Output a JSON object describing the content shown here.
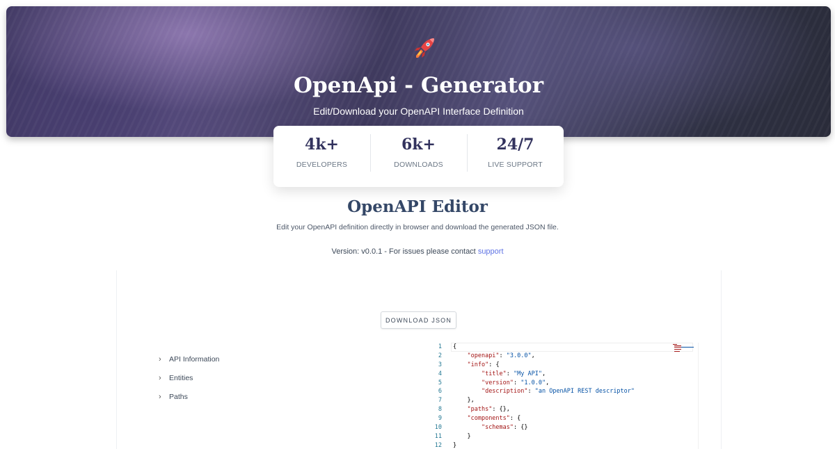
{
  "hero": {
    "title": "OpenApi - Generator",
    "subtitle": "Edit/Download your OpenAPI Interface Definition",
    "icon": "rocket-icon"
  },
  "stats": [
    {
      "value": "4k+",
      "label": "DEVELOPERS"
    },
    {
      "value": "6k+",
      "label": "DOWNLOADS"
    },
    {
      "value": "24/7",
      "label": "LIVE SUPPORT"
    }
  ],
  "editor": {
    "title": "OpenAPI Editor",
    "description": "Edit your OpenAPI definition directly in browser and download the generated JSON file.",
    "version_text": "Version: v0.0.1 - For issues please contact",
    "support_label": "support",
    "download_label": "DOWNLOAD JSON"
  },
  "tree": {
    "items": [
      {
        "label": "API Information"
      },
      {
        "label": "Entities"
      },
      {
        "label": "Paths"
      }
    ]
  },
  "code": {
    "line_numbers": [
      "1",
      "2",
      "3",
      "4",
      "5",
      "6",
      "7",
      "8",
      "9",
      "10",
      "11",
      "12"
    ],
    "lines": [
      "{",
      "    \"openapi\": \"3.0.0\",",
      "    \"info\": {",
      "        \"title\": \"My API\",",
      "        \"version\": \"1.0.0\",",
      "        \"description\": \"an OpenAPI REST descriptor\"",
      "    },",
      "    \"paths\": {},",
      "    \"components\": {",
      "        \"schemas\": {}",
      "    }",
      "}"
    ]
  },
  "colors": {
    "accent": "#5e72e4",
    "json_key": "#a31515",
    "json_string": "#0451a5",
    "line_number": "#237893"
  }
}
